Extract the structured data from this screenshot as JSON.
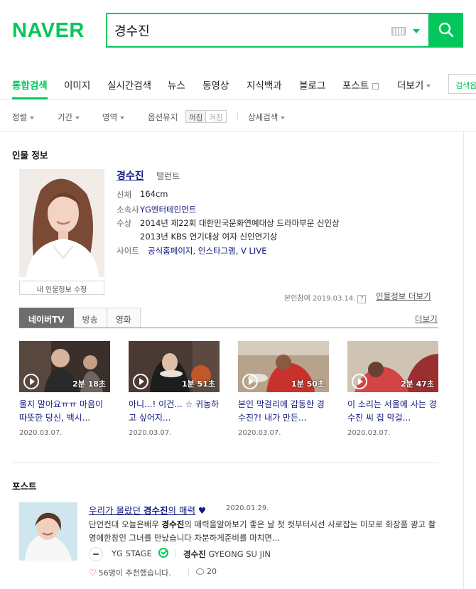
{
  "header": {
    "logo": "NAVER",
    "query": "경수진"
  },
  "nav": {
    "tabs": [
      "통합검색",
      "이미지",
      "실시간검색",
      "뉴스",
      "동영상",
      "지식백과",
      "블로그",
      "포스트",
      "더보기"
    ],
    "extra": "검색옵"
  },
  "options": {
    "sort": "정렬",
    "period": "기간",
    "area": "영역",
    "keep": "옵션유지",
    "keep_off": "꺼짐",
    "keep_on": "켜짐",
    "detail": "상세검색"
  },
  "person": {
    "section_title": "인물 정보",
    "name": "경수진",
    "job": "탤런트",
    "rows": [
      {
        "label": "신체",
        "value": "164cm"
      },
      {
        "label": "소속사",
        "value": "YG엔터테인먼트"
      },
      {
        "label": "수상",
        "value": "2014년 제22회 대한민국문화연예대상 드라마부문 신인상"
      },
      {
        "label": "",
        "value": "2013년 KBS 연기대상 여자 신인연기상"
      },
      {
        "label": "사이트",
        "value": "공식홈페이지, 인스타그램, V LIVE"
      }
    ],
    "edit_button": "내 인물정보 수정",
    "ref": "본인참여 2019.03.14.",
    "help": "?",
    "more_info": "인물정보 더보기"
  },
  "media": {
    "tabs": [
      "네이버TV",
      "방송",
      "영화"
    ],
    "more": "더보기",
    "videos": [
      {
        "duration": "2분 18초",
        "title": "울지 말아요ㅠㅠ 마음이 따뜻한 당신, 백시...",
        "date": "2020.03.07."
      },
      {
        "duration": "1분 51초",
        "title": "아니...! 이건... ☆ 귀농하고 싶어지...",
        "date": "2020.03.07."
      },
      {
        "duration": "1분 50초",
        "title": "본인 막걸리에 감동한 경수진?! 내가 만든...",
        "date": "2020.03.07."
      },
      {
        "duration": "2분 47초",
        "title": "이 소리는 서울에 사는 경수진 씨 집 막걸...",
        "date": "2020.03.07."
      }
    ]
  },
  "post": {
    "section_title": "포스트",
    "title_prefix": "우리가 몰랐던 ",
    "title_name": "경수진",
    "title_suffix": "의 매력",
    "title_heart": " ♥",
    "date": "2020.01.29.",
    "text_prefix": "단언컨대 오늘은배우 ",
    "text_name": "경수진",
    "text_rest": "의 매력을알아보기 좋은 날  첫 컷부터시선 사로잡는 미모로 화장품 광고 촬영에한창인 그녀를 만났습니다  차분하게준비를 마치면...",
    "author": "YG STAGE",
    "sub_name": "경수진",
    "sub_rest": " GYEONG SU JIN",
    "likes": "56명이 추천했습니다.",
    "comments": "20"
  }
}
